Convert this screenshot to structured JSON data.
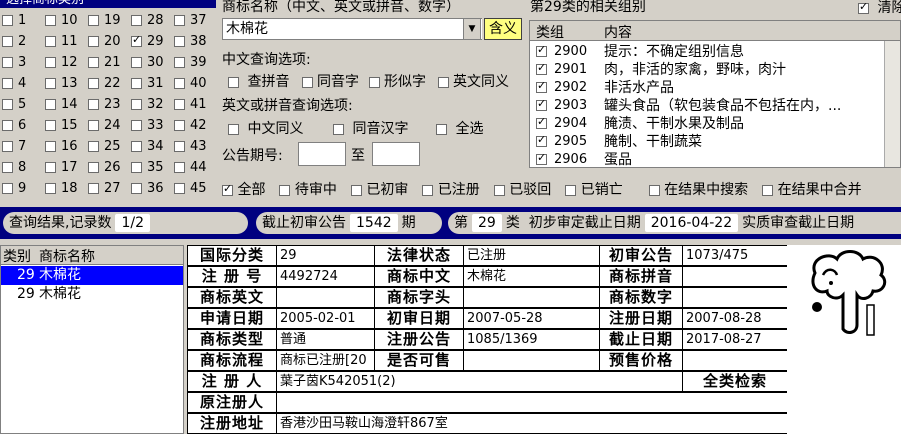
{
  "class_selector": {
    "title": "选择商标类别",
    "columns": [
      [
        {
          "n": "1",
          "on": false
        },
        {
          "n": "2",
          "on": false
        },
        {
          "n": "3",
          "on": false
        },
        {
          "n": "4",
          "on": false
        },
        {
          "n": "5",
          "on": false
        },
        {
          "n": "6",
          "on": false
        },
        {
          "n": "7",
          "on": false
        },
        {
          "n": "8",
          "on": false
        },
        {
          "n": "9",
          "on": false
        }
      ],
      [
        {
          "n": "10",
          "on": false
        },
        {
          "n": "11",
          "on": false
        },
        {
          "n": "12",
          "on": false
        },
        {
          "n": "13",
          "on": false
        },
        {
          "n": "14",
          "on": false
        },
        {
          "n": "15",
          "on": false
        },
        {
          "n": "16",
          "on": false
        },
        {
          "n": "17",
          "on": false
        },
        {
          "n": "18",
          "on": false
        }
      ],
      [
        {
          "n": "19",
          "on": false
        },
        {
          "n": "20",
          "on": false
        },
        {
          "n": "21",
          "on": false
        },
        {
          "n": "22",
          "on": false
        },
        {
          "n": "23",
          "on": false
        },
        {
          "n": "24",
          "on": false
        },
        {
          "n": "25",
          "on": false
        },
        {
          "n": "26",
          "on": false
        },
        {
          "n": "27",
          "on": false
        }
      ],
      [
        {
          "n": "28",
          "on": false
        },
        {
          "n": "29",
          "on": true
        },
        {
          "n": "30",
          "on": false
        },
        {
          "n": "31",
          "on": false
        },
        {
          "n": "32",
          "on": false
        },
        {
          "n": "33",
          "on": false
        },
        {
          "n": "34",
          "on": false
        },
        {
          "n": "35",
          "on": false
        },
        {
          "n": "36",
          "on": false
        }
      ],
      [
        {
          "n": "37",
          "on": false
        },
        {
          "n": "38",
          "on": false
        },
        {
          "n": "39",
          "on": false
        },
        {
          "n": "40",
          "on": false
        },
        {
          "n": "41",
          "on": false
        },
        {
          "n": "42",
          "on": false
        },
        {
          "n": "43",
          "on": false
        },
        {
          "n": "44",
          "on": false
        },
        {
          "n": "45",
          "on": false
        }
      ]
    ]
  },
  "query": {
    "name_label": "商标名称（中文、英文或拼音、数字）",
    "name_value": "木棉花",
    "hanyi_button": "含义",
    "cn_options_label": "中文查询选项:",
    "cn_options": [
      "查拼音",
      "同音字",
      "形似字",
      "英文同义"
    ],
    "en_options_label": "英文或拼音查询选项:",
    "en_options": [
      "中文同义",
      "同音汉字",
      "全选"
    ],
    "period_label": "公告期号:",
    "period_to": "至"
  },
  "groups": {
    "title": "第29类的相关组别",
    "clear_label": "清除",
    "col_group": "类组",
    "col_content": "内容",
    "rows": [
      {
        "code": "2900",
        "text": "提示：不确定组别信息"
      },
      {
        "code": "2901",
        "text": "肉，非活的家禽，野味，肉汁"
      },
      {
        "code": "2902",
        "text": "非活水产品"
      },
      {
        "code": "2903",
        "text": "罐头食品（软包装食品不包括在内，..."
      },
      {
        "code": "2904",
        "text": "腌渍、干制水果及制品"
      },
      {
        "code": "2905",
        "text": "腌制、干制蔬菜"
      },
      {
        "code": "2906",
        "text": "蛋品"
      }
    ]
  },
  "filters": [
    "全部",
    "待审中",
    "已初审",
    "已注册",
    "已驳回",
    "已销亡",
    "在结果中搜索",
    "在结果中合并"
  ],
  "result_bar": {
    "results_label": "查询结果,记录数",
    "results_value": "1/2",
    "cutoff_label": "截止初审公告",
    "cutoff_value": "1542",
    "cutoff_unit": "期",
    "class_prefix": "第",
    "class_value": "29",
    "class_suffix": "类",
    "prelim_label": "初步审定截止日期",
    "prelim_value": "2016-04-22",
    "substantive_label": "实质审查截止日期"
  },
  "result_list": {
    "col_class": "类别",
    "col_name": "商标名称",
    "rows": [
      {
        "cls": "29",
        "name": "木棉花"
      },
      {
        "cls": "29",
        "name": "木棉花"
      }
    ]
  },
  "detail": {
    "intl_class_label": "国际分类",
    "intl_class": "29",
    "legal_status_label": "法律状态",
    "legal_status": "已注册",
    "prelim_pub_label": "初审公告",
    "prelim_pub": "1073/475",
    "reg_no_label": "注 册 号",
    "reg_no": "4492724",
    "mark_cn_label": "商标中文",
    "mark_cn": "木棉花",
    "mark_pinyin_label": "商标拼音",
    "mark_pinyin": "",
    "mark_en_label": "商标英文",
    "mark_en": "",
    "mark_initial_label": "商标字头",
    "mark_initial": "",
    "mark_digits_label": "商标数字",
    "mark_digits": "",
    "apply_date_label": "申请日期",
    "apply_date": "2005-02-01",
    "prelim_date_label": "初审日期",
    "prelim_date": "2007-05-28",
    "reg_date_label": "注册日期",
    "reg_date": "2007-08-28",
    "mark_type_label": "商标类型",
    "mark_type": "普通",
    "reg_pub_label": "注册公告",
    "reg_pub": "1085/1369",
    "expire_date_label": "截止日期",
    "expire_date": "2017-08-27",
    "flow_label": "商标流程",
    "flow": "商标已注册[20",
    "for_sale_label": "是否可售",
    "for_sale": "",
    "pre_price_label": "预售价格",
    "pre_price": "",
    "registrant_label": "注 册 人",
    "registrant": "葉子茵K542051(2)",
    "full_search": "全类检索",
    "orig_registrant_label": "原注册人",
    "orig_registrant": "",
    "reg_address_label": "注册地址",
    "reg_address": "香港沙田马鞍山海澄轩867室"
  },
  "colors": {
    "titlebar": "#000080",
    "selection": "#0000ff",
    "face": "#d4d0c8",
    "hanyi_button": "#ffff80"
  }
}
